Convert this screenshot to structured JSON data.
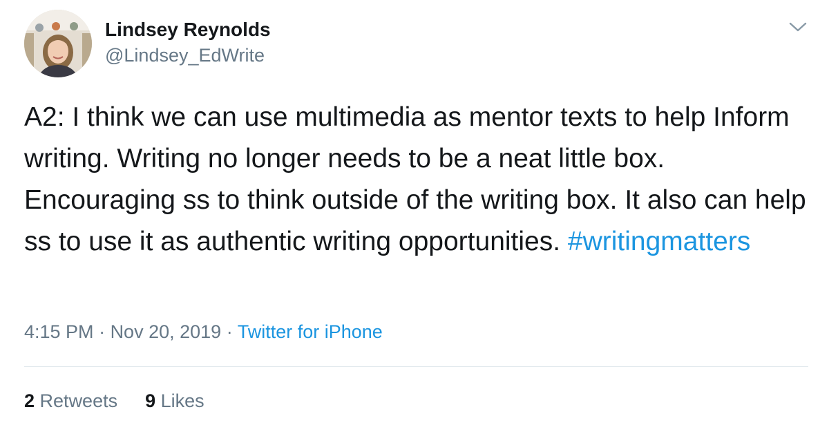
{
  "author": {
    "name": "Lindsey Reynolds",
    "handle": "@Lindsey_EdWrite"
  },
  "tweet": {
    "text": "A2: I think we can use multimedia as mentor texts to help Inform writing. Writing no longer needs to be a neat little box. Encouraging ss to think outside of the writing box. It also can help ss to use it as authentic writing opportunities. ",
    "hashtag": "#writingmatters",
    "time": "4:15 PM",
    "date": "Nov 20, 2019",
    "separator": " · ",
    "source": "Twitter for iPhone"
  },
  "stats": {
    "retweets_count": "2",
    "retweets_label": "Retweets",
    "likes_count": "9",
    "likes_label": "Likes"
  },
  "icons": {
    "caret": "chevron-down-icon"
  },
  "colors": {
    "link": "#1b95e0",
    "secondary_text": "#657786",
    "primary_text": "#14171a",
    "divider": "#e1e8ed"
  }
}
